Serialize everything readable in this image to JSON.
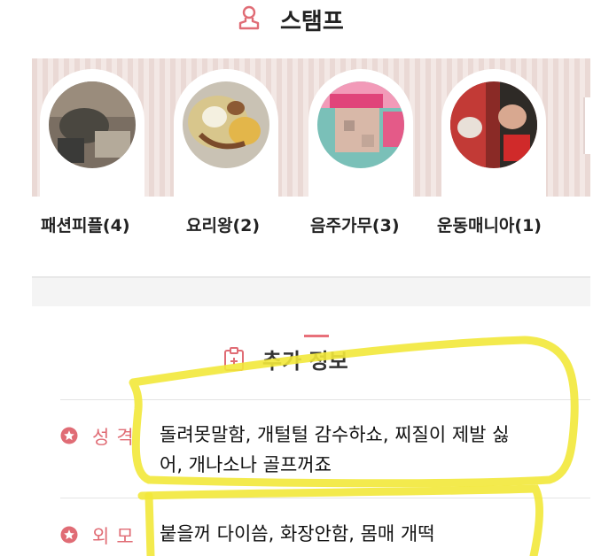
{
  "stamp": {
    "title": "스탬프",
    "items": [
      {
        "label": "패션피플(4)"
      },
      {
        "label": "요리왕(2)"
      },
      {
        "label": "음주가무(3)"
      },
      {
        "label": "운동매니아(1)"
      }
    ]
  },
  "extra_info": {
    "title": "추가 정보",
    "rows": [
      {
        "label": "성격",
        "value_line1": "돌려못말함, 개털털 감수하쇼, 찌질이 제발 싫",
        "value_line2": "어, 개나소나 골프꺼죠"
      },
      {
        "label": "외모",
        "value_line1": "붙을꺼 다이씀, 화장안함, 몸매 개떡"
      }
    ]
  },
  "colors": {
    "accent": "#e06c75",
    "highlighter": "#f2e83a",
    "band": "#ead9d5"
  }
}
